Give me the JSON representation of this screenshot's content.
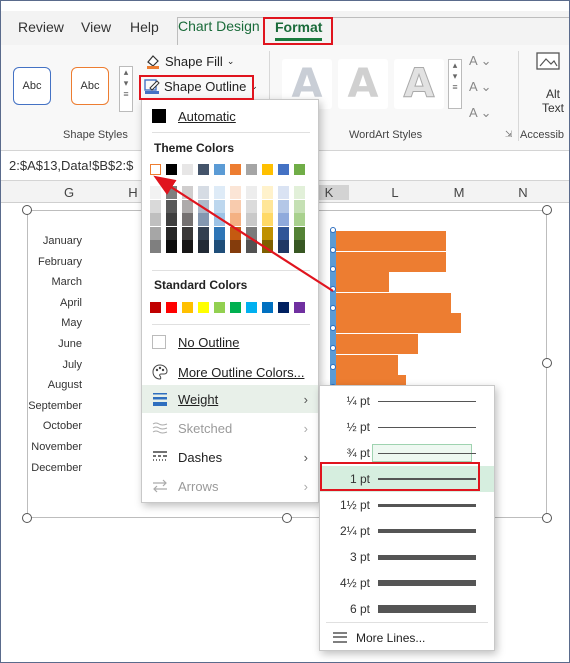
{
  "ribbon_tabs": [
    {
      "label": "Review"
    },
    {
      "label": "View"
    },
    {
      "label": "Help"
    },
    {
      "label": "Chart Design"
    },
    {
      "label": "Format"
    }
  ],
  "shape_styles": {
    "preset_1": "Abc",
    "preset_2": "Abc",
    "shape_fill": "Shape Fill",
    "shape_outline": "Shape Outline",
    "group_label": "Shape Styles",
    "preset_1_color": "#4472c4",
    "preset_2_color": "#ed7d31"
  },
  "wordart": {
    "sample": "A",
    "group_label": "WordArt Styles",
    "side_glyph": "A"
  },
  "accessibility": {
    "alt_text": "Alt Text",
    "group_label": "Accessib"
  },
  "formula_bar": {
    "text": "2:$A$13,Data!$B$2:$"
  },
  "columns": [
    "G",
    "H",
    "K",
    "L",
    "M",
    "N"
  ],
  "months": [
    "January",
    "February",
    "March",
    "April",
    "May",
    "June",
    "July",
    "August",
    "September",
    "October",
    "November",
    "December"
  ],
  "bar_values": [
    0.46,
    0.46,
    0.22,
    0.48,
    0.52,
    0.34,
    0.26,
    0.29,
    0.57,
    0,
    0,
    0
  ],
  "shape_outline_menu": {
    "automatic": "Automatic",
    "theme_colors_heading": "Theme Colors",
    "theme_colors": [
      "#ffffff",
      "#000000",
      "#e7e6e6",
      "#44546a",
      "#5b9bd5",
      "#ed7d31",
      "#a5a5a5",
      "#ffc000",
      "#4472c4",
      "#70ad47"
    ],
    "standard_colors_heading": "Standard Colors",
    "standard_colors": [
      "#c00000",
      "#ff0000",
      "#ffc000",
      "#ffff00",
      "#92d050",
      "#00b050",
      "#00b0f0",
      "#0070c0",
      "#002060",
      "#7030a0"
    ],
    "no_outline": "No Outline",
    "more_colors": "More Outline Colors...",
    "weight": "Weight",
    "sketched": "Sketched",
    "dashes": "Dashes",
    "arrows": "Arrows"
  },
  "weight_submenu": {
    "options": [
      "¼ pt",
      "½ pt",
      "¾ pt",
      "1 pt",
      "1½ pt",
      "2¼ pt",
      "3 pt",
      "4½ pt",
      "6 pt"
    ],
    "selected": "1 pt",
    "more_lines": "More Lines..."
  }
}
